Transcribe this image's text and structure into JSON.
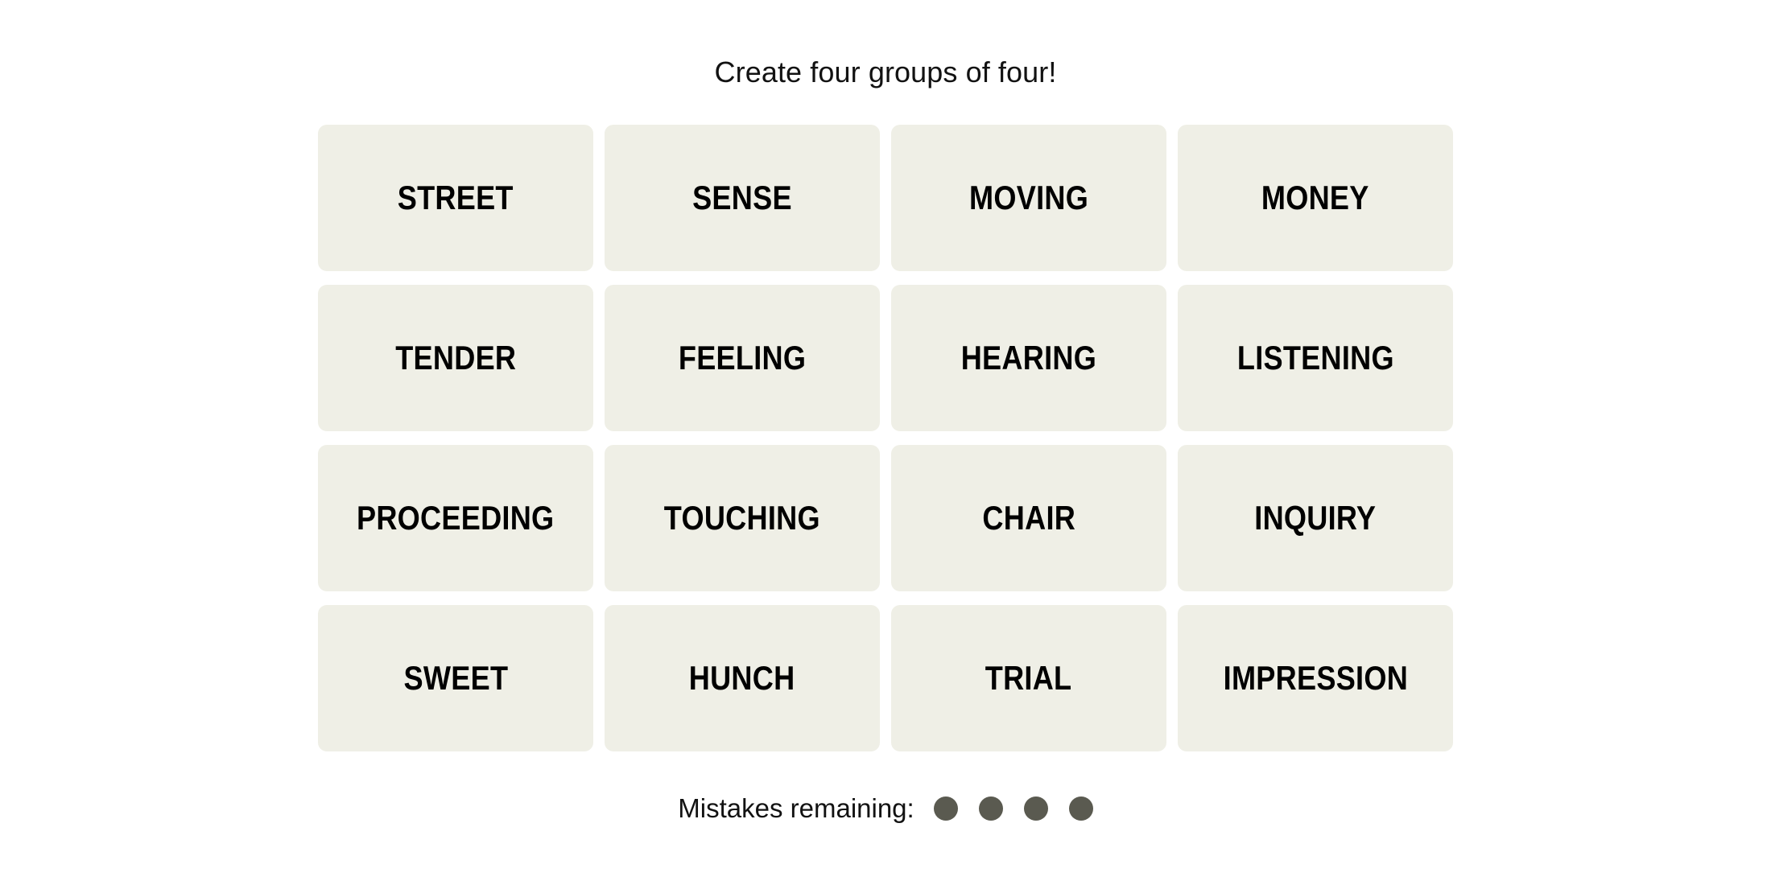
{
  "game": {
    "title": "Create four groups of four!",
    "board": {
      "rows": [
        [
          "STREET",
          "SENSE",
          "MOVING",
          "MONEY"
        ],
        [
          "TENDER",
          "FEELING",
          "HEARING",
          "LISTENING"
        ],
        [
          "PROCEEDING",
          "TOUCHING",
          "CHAIR",
          "INQUIRY"
        ],
        [
          "SWEET",
          "HUNCH",
          "TRIAL",
          "IMPRESSION"
        ]
      ],
      "tiles": [
        "STREET",
        "SENSE",
        "MOVING",
        "MONEY",
        "TENDER",
        "FEELING",
        "HEARING",
        "LISTENING",
        "PROCEEDING",
        "TOUCHING",
        "CHAIR",
        "INQUIRY",
        "SWEET",
        "HUNCH",
        "TRIAL",
        "IMPRESSION"
      ]
    },
    "mistakes": {
      "label": "Mistakes remaining:",
      "remaining": 4,
      "dots": [
        "dot",
        "dot",
        "dot",
        "dot"
      ]
    },
    "colors": {
      "page_background": "#ffffff",
      "tile_background": "#efefe6",
      "tile_text": "#000000",
      "title_text": "#121212",
      "mistake_dot": "#5a5a50"
    }
  }
}
